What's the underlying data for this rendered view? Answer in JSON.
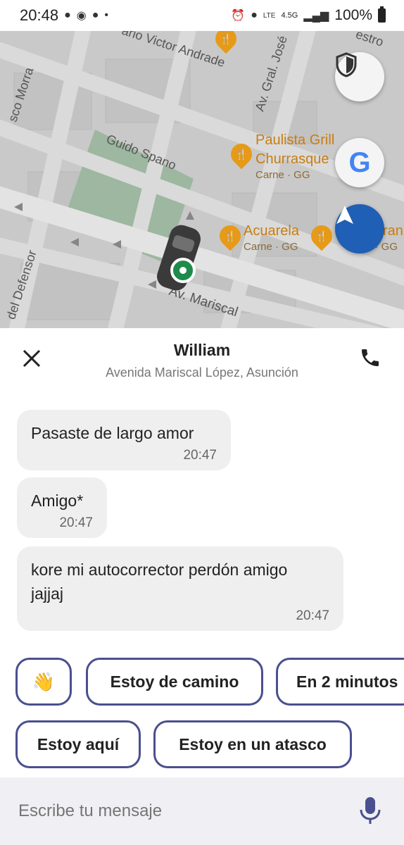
{
  "status_bar": {
    "time": "20:48",
    "network": "4.5G",
    "battery": "100%"
  },
  "map": {
    "streets": [
      "ario Victor Andrade",
      "Av. Gral. José",
      "sco Morra",
      "Guido Spano",
      "del Defensor",
      "Av. Mariscal",
      "estro"
    ],
    "pois": [
      {
        "name": "Paulista Grill Churrasque",
        "line1": "Paulista Grill",
        "line2": "Churrasque",
        "sub": "Carne · GG"
      },
      {
        "name": "Acuarela",
        "sub": "Carne · GG"
      },
      {
        "name": "ran",
        "sub": "a · GG"
      }
    ],
    "buttons": {
      "shield": "shield-icon",
      "google": "G",
      "navigate": "navigation-arrow-icon"
    }
  },
  "header": {
    "name": "William",
    "address": "Avenida Mariscal López, Asunción"
  },
  "messages": [
    {
      "text": "Pasaste de largo amor",
      "time": "20:47"
    },
    {
      "text": "Amigo*",
      "time": "20:47"
    },
    {
      "text_line1": "kore mi autocorrector perdón amigo",
      "text_line2": "jajjaj",
      "time": "20:47"
    }
  ],
  "quick_replies": [
    {
      "label": "👋"
    },
    {
      "label": "Estoy de camino"
    },
    {
      "label": "En 2 minutos"
    },
    {
      "label": "Estoy aquí"
    },
    {
      "label": "Estoy en un atasco"
    }
  ],
  "input": {
    "placeholder": "Escribe tu mensaje"
  },
  "colors": {
    "accent": "#4a4f8f",
    "poi": "#e69a18",
    "navigation": "#1f5fb5",
    "rider": "#1e8a4c"
  }
}
